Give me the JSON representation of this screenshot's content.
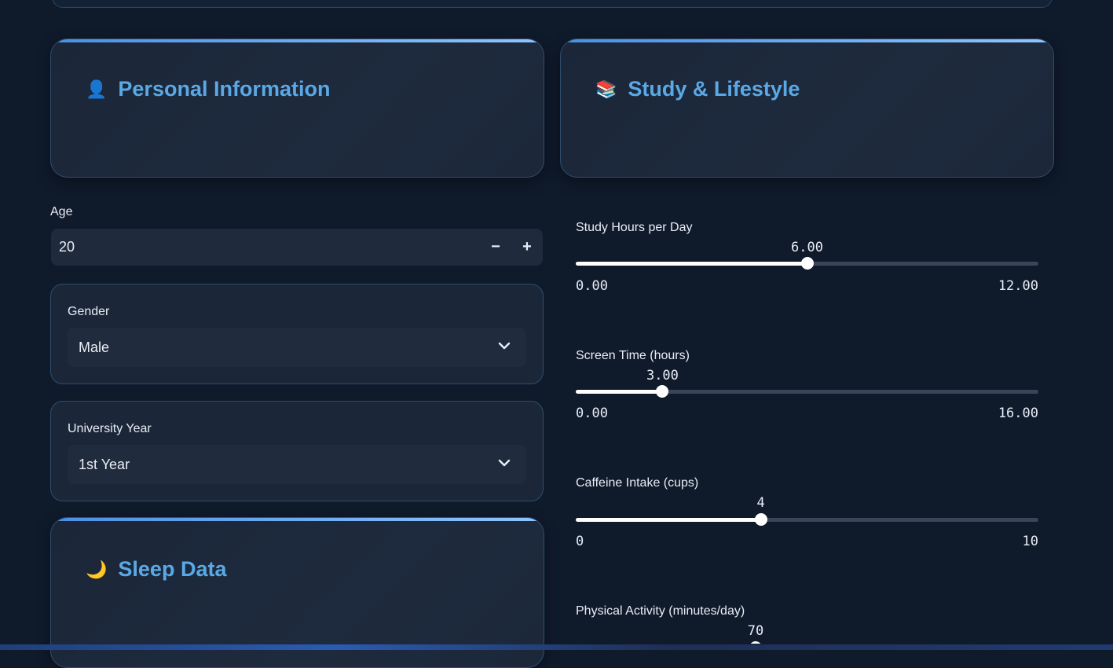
{
  "personal": {
    "title": "Personal Information",
    "icon": "👤",
    "age_label": "Age",
    "age_value": "20",
    "minus": "−",
    "plus": "+",
    "gender_label": "Gender",
    "gender_value": "Male",
    "year_label": "University Year",
    "year_value": "1st Year"
  },
  "study": {
    "title": "Study & Lifestyle",
    "icon": "📚"
  },
  "sleep": {
    "title": "Sleep Data",
    "icon": "🌙"
  },
  "sliders": [
    {
      "label": "Study Hours per Day",
      "value": 6,
      "value_text": "6.00",
      "min": 0,
      "min_text": "0.00",
      "max": 12,
      "max_text": "12.00"
    },
    {
      "label": "Screen Time (hours)",
      "value": 3,
      "value_text": "3.00",
      "min": 0,
      "min_text": "0.00",
      "max": 16,
      "max_text": "16.00"
    },
    {
      "label": "Caffeine Intake (cups)",
      "value": 4,
      "value_text": "4",
      "min": 0,
      "min_text": "0",
      "max": 10,
      "max_text": "10"
    },
    {
      "label": "Physical Activity (minutes/day)",
      "value_text": "70"
    }
  ]
}
